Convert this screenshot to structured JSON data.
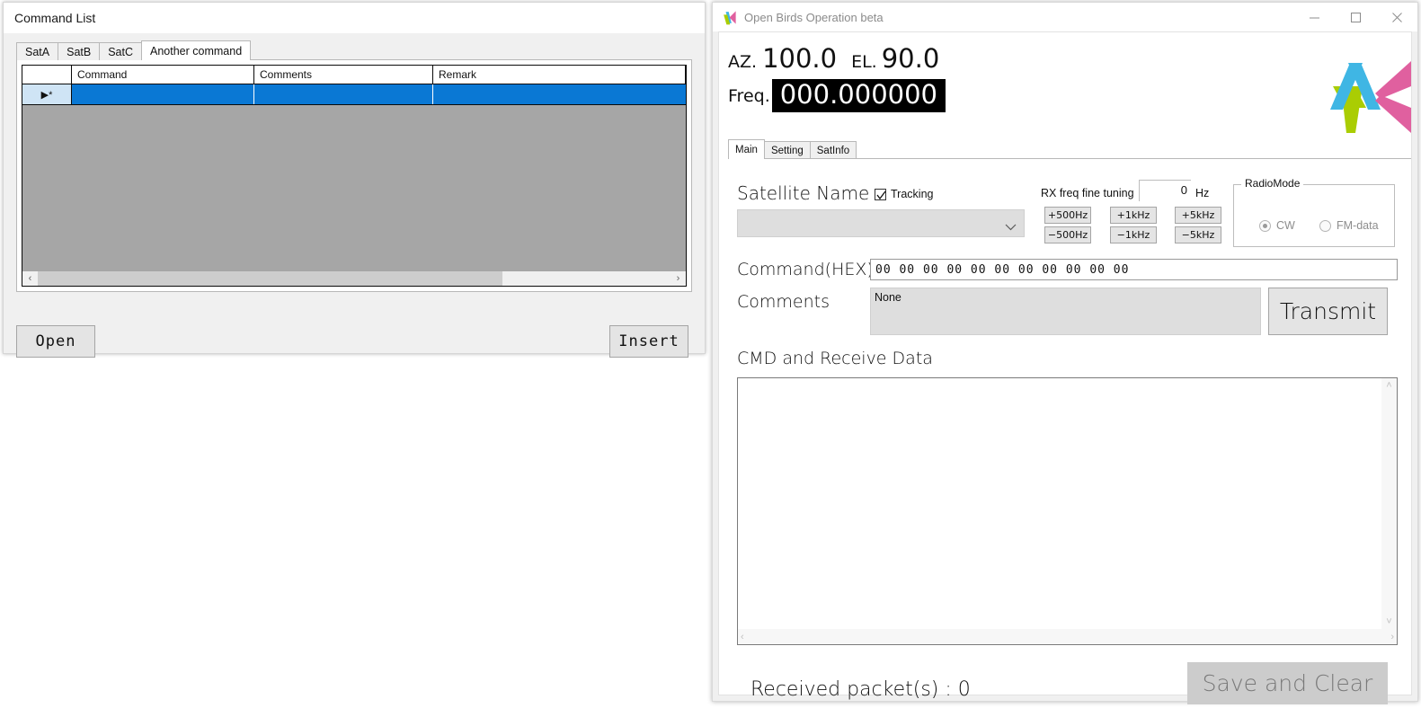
{
  "command_list_window": {
    "title": "Command List",
    "tabs": [
      {
        "label": "SatA",
        "active": false
      },
      {
        "label": "SatB",
        "active": false
      },
      {
        "label": "SatC",
        "active": false
      },
      {
        "label": "Another command",
        "active": true
      }
    ],
    "grid": {
      "columns": [
        "",
        "Command",
        "Comments",
        "Remark"
      ],
      "rows": [
        {
          "marker": "▶*",
          "command": "",
          "comments": "",
          "remark": "",
          "selected": true
        }
      ],
      "selection_color": "#0a78d4",
      "row_header_color": "#cfe4f5",
      "empty_area_color": "#a6a6a6"
    },
    "scrollbar": {
      "left_arrow": "‹",
      "right_arrow": "›"
    },
    "buttons": {
      "open": "Open",
      "insert": "Insert"
    }
  },
  "main_window": {
    "title": "Open Birds Operation beta",
    "window_controls": {
      "minimize": "minimize-icon",
      "maximize": "maximize-icon",
      "close": "close-icon"
    },
    "readout": {
      "az_label": "AZ.",
      "az_value": "100.0",
      "el_label": "EL.",
      "el_value": "90.0",
      "freq_label": "Freq.",
      "freq_value": "000.000000",
      "freq_bg": "#000000",
      "freq_fg": "#ffffff"
    },
    "logo": {
      "name": "app-logo",
      "colors": [
        "#3fb6e4",
        "#aacd03",
        "#e0609f"
      ]
    },
    "tabs": [
      {
        "label": "Main",
        "active": true
      },
      {
        "label": "Setting",
        "active": false
      },
      {
        "label": "SatInfo",
        "active": false
      }
    ],
    "main_tab": {
      "satellite_name_label": "Satellite Name",
      "satellite_name_value": "",
      "tracking_label": "Tracking",
      "tracking_checked": true,
      "rx_tune_label": "RX freq fine tuning",
      "hz_value": "0",
      "hz_unit": "Hz",
      "tune_buttons": [
        {
          "id": "plus-500hz",
          "label": "+500Hz"
        },
        {
          "id": "plus-1khz",
          "label": "+1kHz"
        },
        {
          "id": "plus-5khz",
          "label": "+5kHz"
        },
        {
          "id": "minus-500hz",
          "label": "−500Hz"
        },
        {
          "id": "minus-1khz",
          "label": "−1kHz"
        },
        {
          "id": "minus-5khz",
          "label": "−5kHz"
        }
      ],
      "radio_mode": {
        "legend": "RadioMode",
        "options": [
          {
            "label": "CW",
            "selected": true
          },
          {
            "label": "FM-data",
            "selected": false
          }
        ]
      },
      "command_hex_label": "Command(HEX)",
      "command_hex_value": "00 00 00 00 00 00 00 00 00 00 00",
      "comments_label": "Comments",
      "comments_value": "None",
      "transmit_label": "Transmit",
      "receive_label": "CMD and Receive Data",
      "receive_value": "",
      "received_packets": "Received packet(s) : 0",
      "save_and_clear_label": "Save and Clear",
      "scroll_glyphs": {
        "up": "˄",
        "down": "˅",
        "left": "‹",
        "right": "›"
      }
    }
  }
}
